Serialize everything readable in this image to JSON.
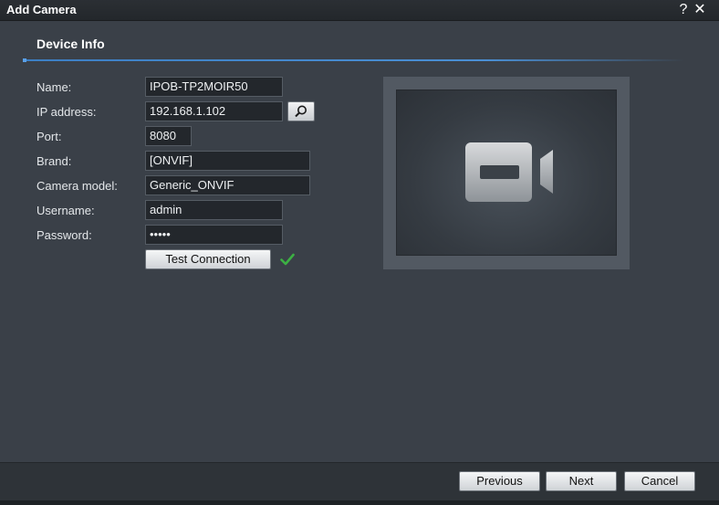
{
  "window": {
    "title": "Add Camera",
    "help_label": "?",
    "close_label": "✕"
  },
  "section": {
    "title": "Device Info"
  },
  "form": {
    "name_label": "Name:",
    "name_value": "IPOB-TP2MOIR50",
    "ip_label": "IP address:",
    "ip_value": "192.168.1.102",
    "port_label": "Port:",
    "port_value": "8080",
    "brand_label": "Brand:",
    "brand_value": "[ONVIF]",
    "model_label": "Camera model:",
    "model_value": "Generic_ONVIF",
    "username_label": "Username:",
    "username_value": "admin",
    "password_label": "Password:",
    "password_value": "•••••",
    "test_button_label": "Test Connection",
    "test_status": "success"
  },
  "icons": {
    "search": "magnifier-icon",
    "check": "check-icon",
    "camera": "video-camera-icon"
  },
  "footer": {
    "previous_label": "Previous",
    "next_label": "Next",
    "cancel_label": "Cancel"
  },
  "colors": {
    "accent": "#3c7fc4",
    "success": "#3cb043",
    "background": "#3a4048"
  }
}
